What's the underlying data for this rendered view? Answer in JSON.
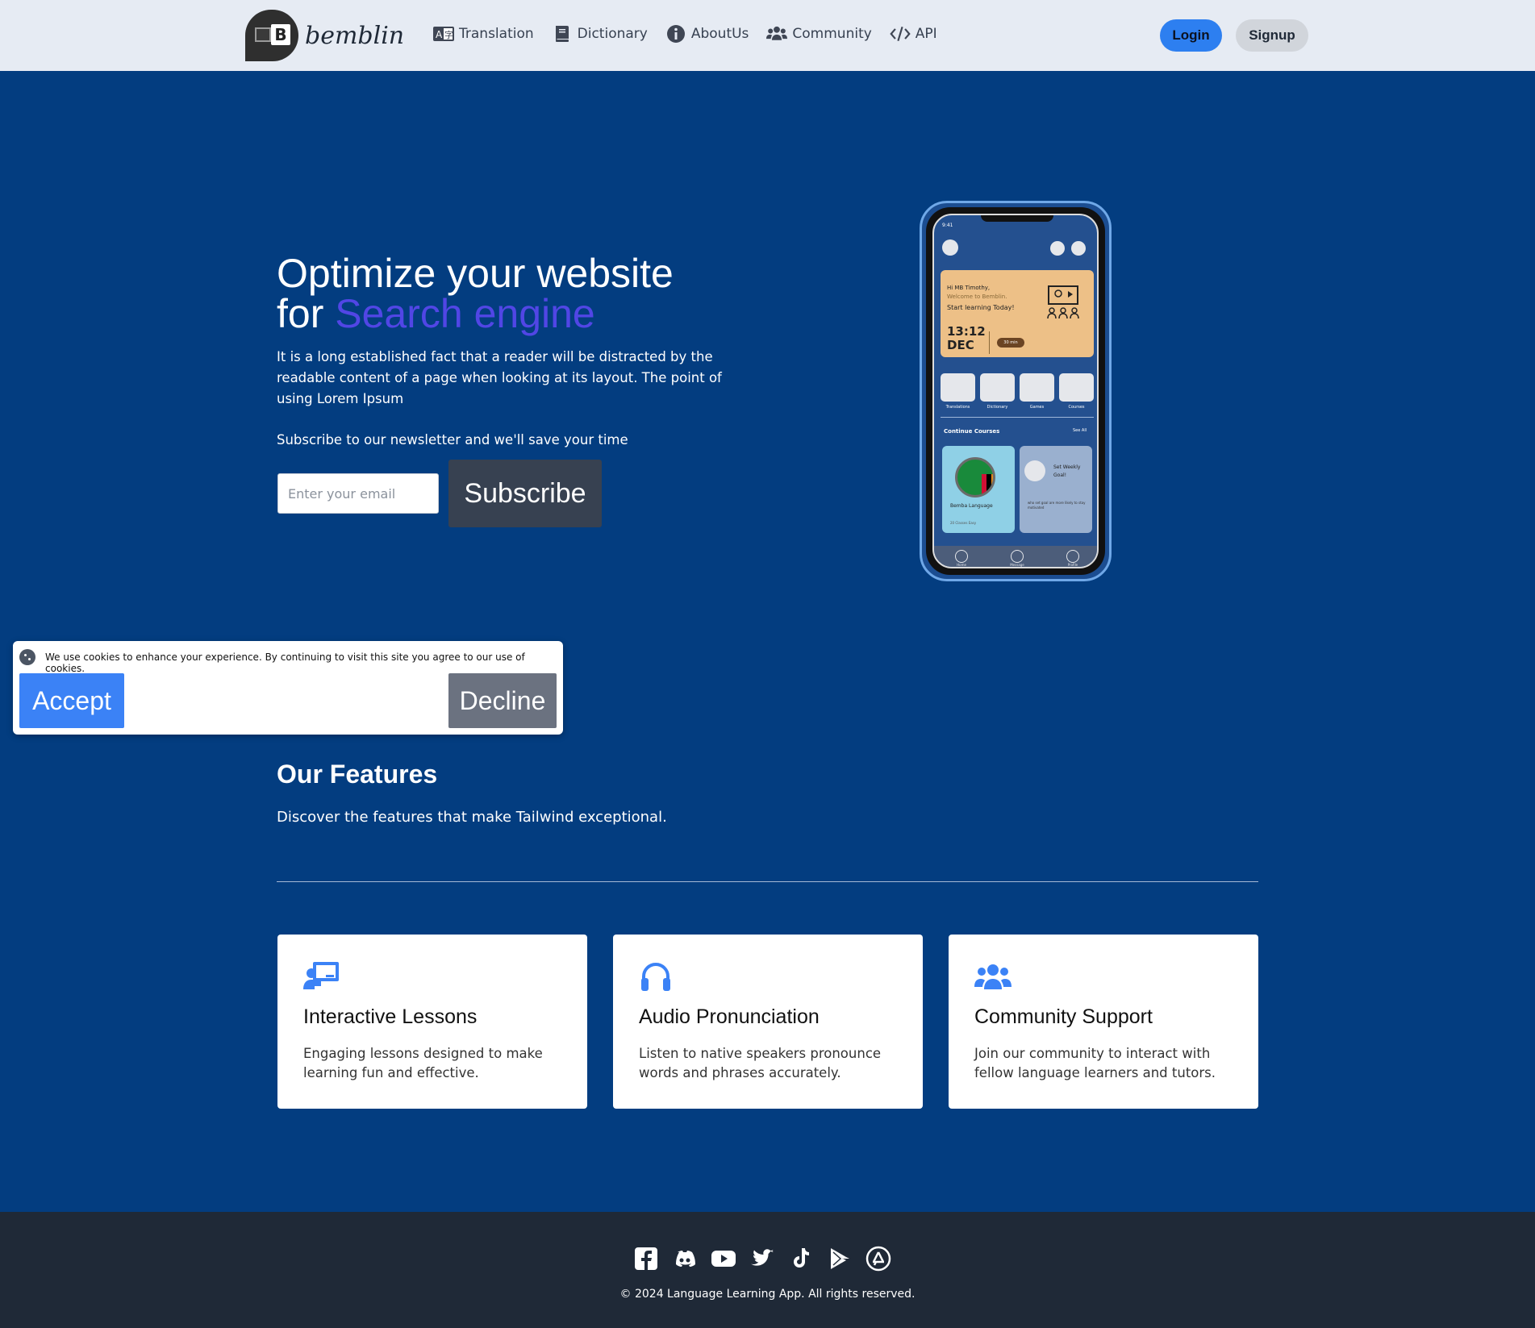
{
  "header": {
    "logo_text": "bemblin",
    "logo_letter": "B",
    "nav": [
      {
        "label": "Translation",
        "icon": "translate-icon"
      },
      {
        "label": "Dictionary",
        "icon": "book-icon"
      },
      {
        "label": "AboutUs",
        "icon": "info-icon"
      },
      {
        "label": "Community",
        "icon": "users-icon"
      },
      {
        "label": "API",
        "icon": "code-icon"
      }
    ],
    "login_label": "Login",
    "signup_label": "Signup"
  },
  "hero": {
    "title_line1": "Optimize your website",
    "title_for": "for",
    "title_accent": "Search engine",
    "description": "It is a long established fact that a reader will be distracted by the readable content of a page when looking at its layout. The point of using Lorem Ipsum",
    "newsletter_text": "Subscribe to our newsletter and we'll save your time",
    "email_placeholder": "Enter your email",
    "subscribe_label": "Subscribe"
  },
  "phone": {
    "status_time": "9:41",
    "greeting": "Hi MB Timothy,",
    "welcome": "Welcome to Bemblin.",
    "start": "Start learning Today!",
    "time": "13:12",
    "month": "DEC",
    "duration": "30 min",
    "categories": [
      "Translations",
      "Dictionary",
      "Games",
      "Courses"
    ],
    "continue_label": "Continue Courses",
    "see_all": "See All",
    "course_name": "Bemba Language",
    "course_sub": "20 Classes Easy",
    "goal_title": "Set Weekly Goal!",
    "goal_sub": "who set goal are more likely to stay motivated",
    "tabs": [
      "Home",
      "Message",
      "Profile"
    ]
  },
  "cookie": {
    "text": "We use cookies to enhance your experience. By continuing to visit this site you agree to our use of cookies.",
    "accept_label": "Accept",
    "decline_label": "Decline"
  },
  "features": {
    "title": "Our Features",
    "subtitle": "Discover the features that make Tailwind exceptional.",
    "cards": [
      {
        "title": "Interactive Lessons",
        "text": "Engaging lessons designed to make learning fun and effective.",
        "icon": "teacher-icon"
      },
      {
        "title": "Audio Pronunciation",
        "text": "Listen to native speakers pronounce words and phrases accurately.",
        "icon": "headphones-icon"
      },
      {
        "title": "Community Support",
        "text": "Join our community to interact with fellow language learners and tutors.",
        "icon": "users-icon"
      }
    ]
  },
  "footer": {
    "socials": [
      "facebook-icon",
      "discord-icon",
      "youtube-icon",
      "twitter-icon",
      "tiktok-icon",
      "google-play-icon",
      "app-store-icon"
    ],
    "copyright": "© 2024 Language Learning App. All rights reserved."
  },
  "colors": {
    "page_bg": "#033d80",
    "accent": "#5146e5",
    "primary_button": "#3b82f6",
    "footer_bg": "#1f2937"
  }
}
